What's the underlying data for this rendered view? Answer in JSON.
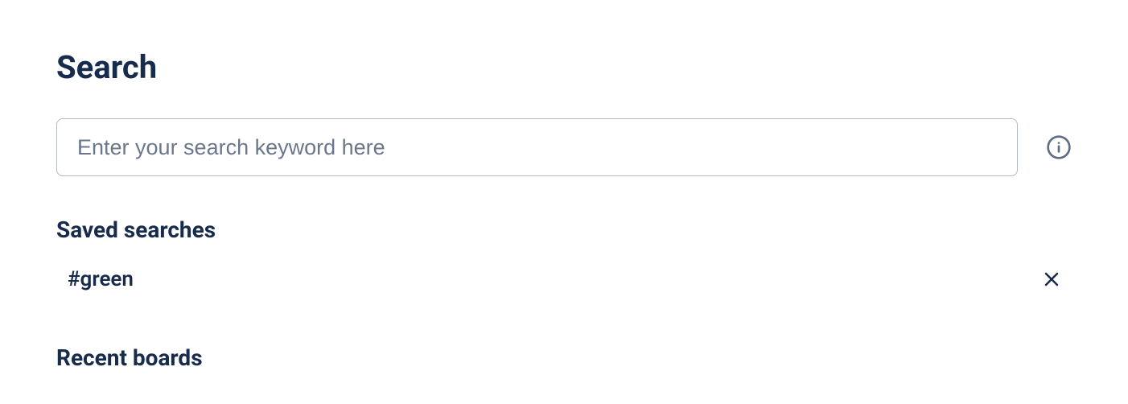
{
  "page": {
    "title": "Search"
  },
  "search": {
    "placeholder": "Enter your search keyword here",
    "value": ""
  },
  "saved_searches": {
    "heading": "Saved searches",
    "items": [
      {
        "label": "#green"
      }
    ]
  },
  "recent_boards": {
    "heading": "Recent boards"
  }
}
